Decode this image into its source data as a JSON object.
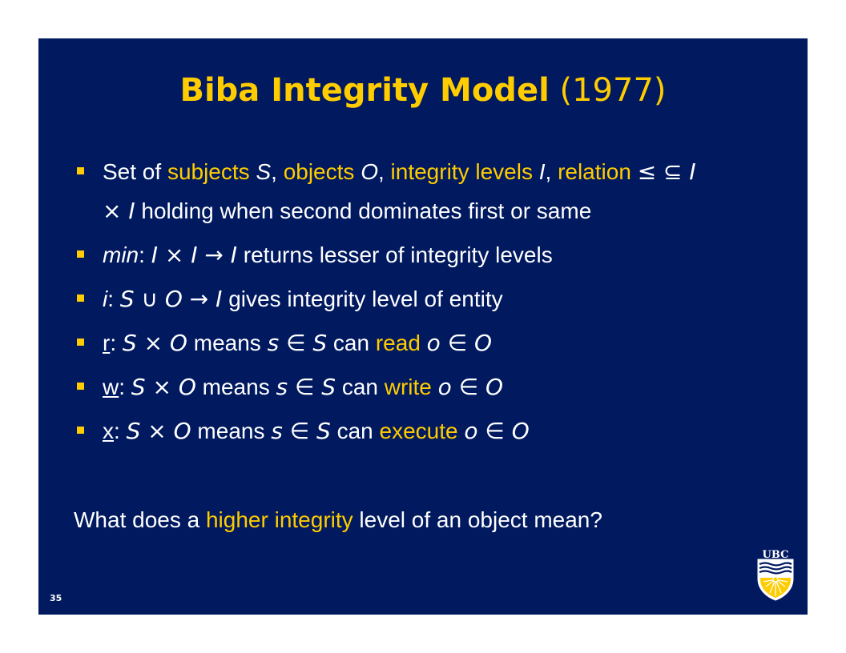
{
  "slide": {
    "title_main": "Biba Integrity Model",
    "title_year": "(1977)",
    "page_number": "35",
    "logo_text": "UBC",
    "colors": {
      "background": "#00195f",
      "accent": "#ffcc00",
      "text": "#ffffff"
    }
  },
  "bullets": [
    {
      "t1": "Set of ",
      "t2": "subjects ",
      "t3": "S",
      "t4": ", ",
      "t5": "objects ",
      "t6": "O",
      "t7": ", ",
      "t8": "integrity levels ",
      "t9": "I",
      "t10": ", ",
      "t11": "relation ",
      "t12": "≤ ⊆ I",
      "t13": "× I",
      "t14": " holding when second dominates first or same"
    },
    {
      "t1": "min",
      "t2": ": ",
      "t3": "I × I → I",
      "t4": " returns lesser of integrity levels"
    },
    {
      "t1": "i",
      "t2": ": ",
      "t3": "S ∪ O → I",
      "t4": " gives integrity level of entity"
    },
    {
      "t1": "r",
      "t2": ": ",
      "t3": "S × O",
      "t4": " means ",
      "t5": "s ∈ S",
      "t6": " can ",
      "t7": "read",
      "t8": " ",
      "t9": "o ∈ O"
    },
    {
      "t1": "w",
      "t2": ": ",
      "t3": "S × O",
      "t4": " means ",
      "t5": "s ∈ S",
      "t6": " can ",
      "t7": "write",
      "t8": " ",
      "t9": "o ∈ O"
    },
    {
      "t1": "x",
      "t2": ": ",
      "t3": "S × O",
      "t4": " means ",
      "t5": "s ∈ S",
      "t6": " can ",
      "t7": "execute",
      "t8": " ",
      "t9": "o ∈ O"
    }
  ],
  "question": {
    "t1": "What does a ",
    "t2": "higher integrity",
    "t3": " level of an object mean?"
  }
}
